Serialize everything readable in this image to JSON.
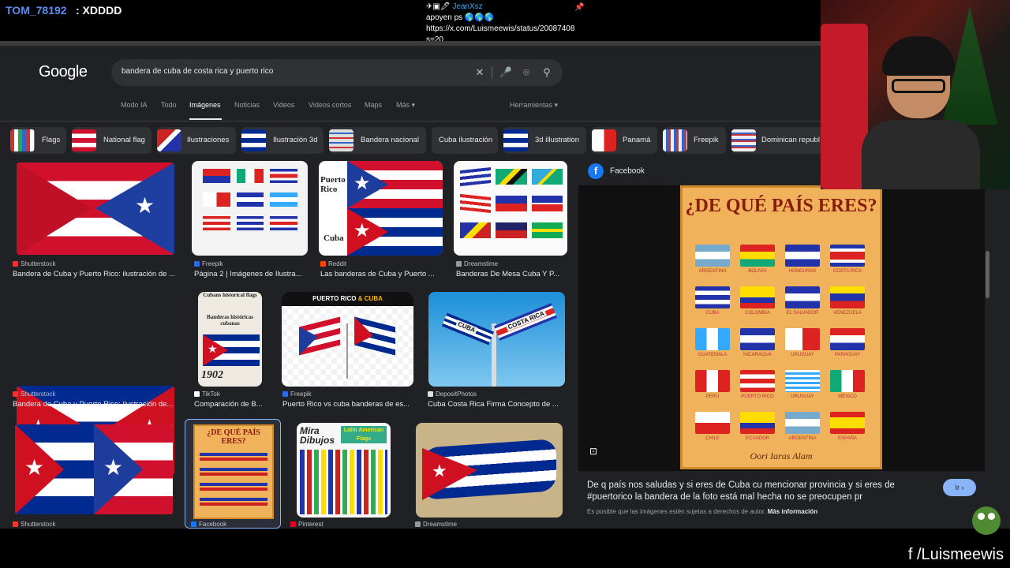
{
  "stream": {
    "chat_user": "TOM_78192",
    "chat_text": ": XDDDD",
    "chat2_user": "JeanXsz",
    "chat2_line1": "apoyen ps 🌎🌎🌎",
    "chat2_line2": "https://x.com/Luismeewis/status/20087408",
    "chat2_line3": "s=20",
    "handle": "f /Luismeewis"
  },
  "google": {
    "logo": "Google",
    "query": "bandera de cuba de costa rica y puerto rico",
    "tabs": [
      "Modo IA",
      "Todo",
      "Imágenes",
      "Noticias",
      "Videos",
      "Videos cortos",
      "Maps",
      "Más ▾"
    ],
    "tools": "Herramientas ▾",
    "chips": [
      "Flags",
      "National flag",
      "Ilustraciones",
      "Ilustración 3d",
      "Bandera nacional",
      "Cuba ilustración",
      "3d illustration",
      "Panamá",
      "Freepik",
      "Dominican republ"
    ]
  },
  "results": [
    {
      "source": "Shutterstock",
      "caption": "Bandera de Cuba y Puerto Rico: ilustración de ..."
    },
    {
      "source": "Freepik",
      "caption": "Página 2 | Imágenes de Ilustra..."
    },
    {
      "source": "Reddit",
      "caption": "Las banderas de Cuba y Puerto ..."
    },
    {
      "source": "Dreamstime",
      "caption": "Banderas De Mesa Cuba Y P..."
    },
    {
      "source": "Shutterstock",
      "caption": "Bandera de Cuba y Puerto Rico: ilustración de..."
    },
    {
      "source": "TikTok",
      "caption": "Comparación de B..."
    },
    {
      "source": "Freepik",
      "caption": "Puerto Rico vs cuba banderas de es..."
    },
    {
      "source": "DepositPhotos",
      "caption": "Cuba Costa Rica Firma Concepto de ..."
    },
    {
      "source": "Shutterstock",
      "caption": ""
    },
    {
      "source": "Facebook",
      "caption": ""
    },
    {
      "source": "Pinterest",
      "caption": ""
    },
    {
      "source": "Dreamstime",
      "caption": ""
    }
  ],
  "tile_texts": {
    "pr_word": "Puerto Rico",
    "cuba_word": "Cuba",
    "historic_title": "Cubans historical flags",
    "historic_sub": "Banderas históricas cubanas",
    "historic_year": "1902",
    "prcuba_header_a": "PUERTO RICO",
    "prcuba_header_amp": "&",
    "prcuba_header_b": "CUBA",
    "sign_a": "CUBA",
    "sign_b": "COSTA RICA",
    "mira_text": "Mira Dibujos",
    "latin_text": "Latin American Flags"
  },
  "panel": {
    "site": "Facebook",
    "poster_title": "¿DE QUÉ PAÍS ERES?",
    "poster_foot": "Oori Iaras Alam",
    "countries": [
      "ARGENTINA",
      "BOLIVIA",
      "HONDURAS",
      "COSTA RICA",
      "CUBA",
      "COLOMBIA",
      "EL SALVADOR",
      "VENEZUELA",
      "GUATEMALA",
      "NICARAGUA",
      "URUGUAY",
      "PARAGUAY",
      "PERÚ",
      "PUERTO RICO",
      "URUGUAY",
      "MÉXICO",
      "CHILE",
      "ECUADOR",
      "ARGENTINA",
      "ESPAÑA"
    ],
    "description": "De q país nos saludas y si eres de Cuba cu mencionar provincia y si eres de #puertorico la bandera de la foto está mal hecha no se preocupen pr",
    "go_label": "Ir ›",
    "copyright": "Es posible que las imágenes estén sujetas a derechos de autor.",
    "more_info": "Más información"
  },
  "colors": {
    "page_bg": "#202124",
    "chip_bg": "#303134",
    "accent": "#8ab4f8",
    "chat_user": "#5b8def"
  }
}
